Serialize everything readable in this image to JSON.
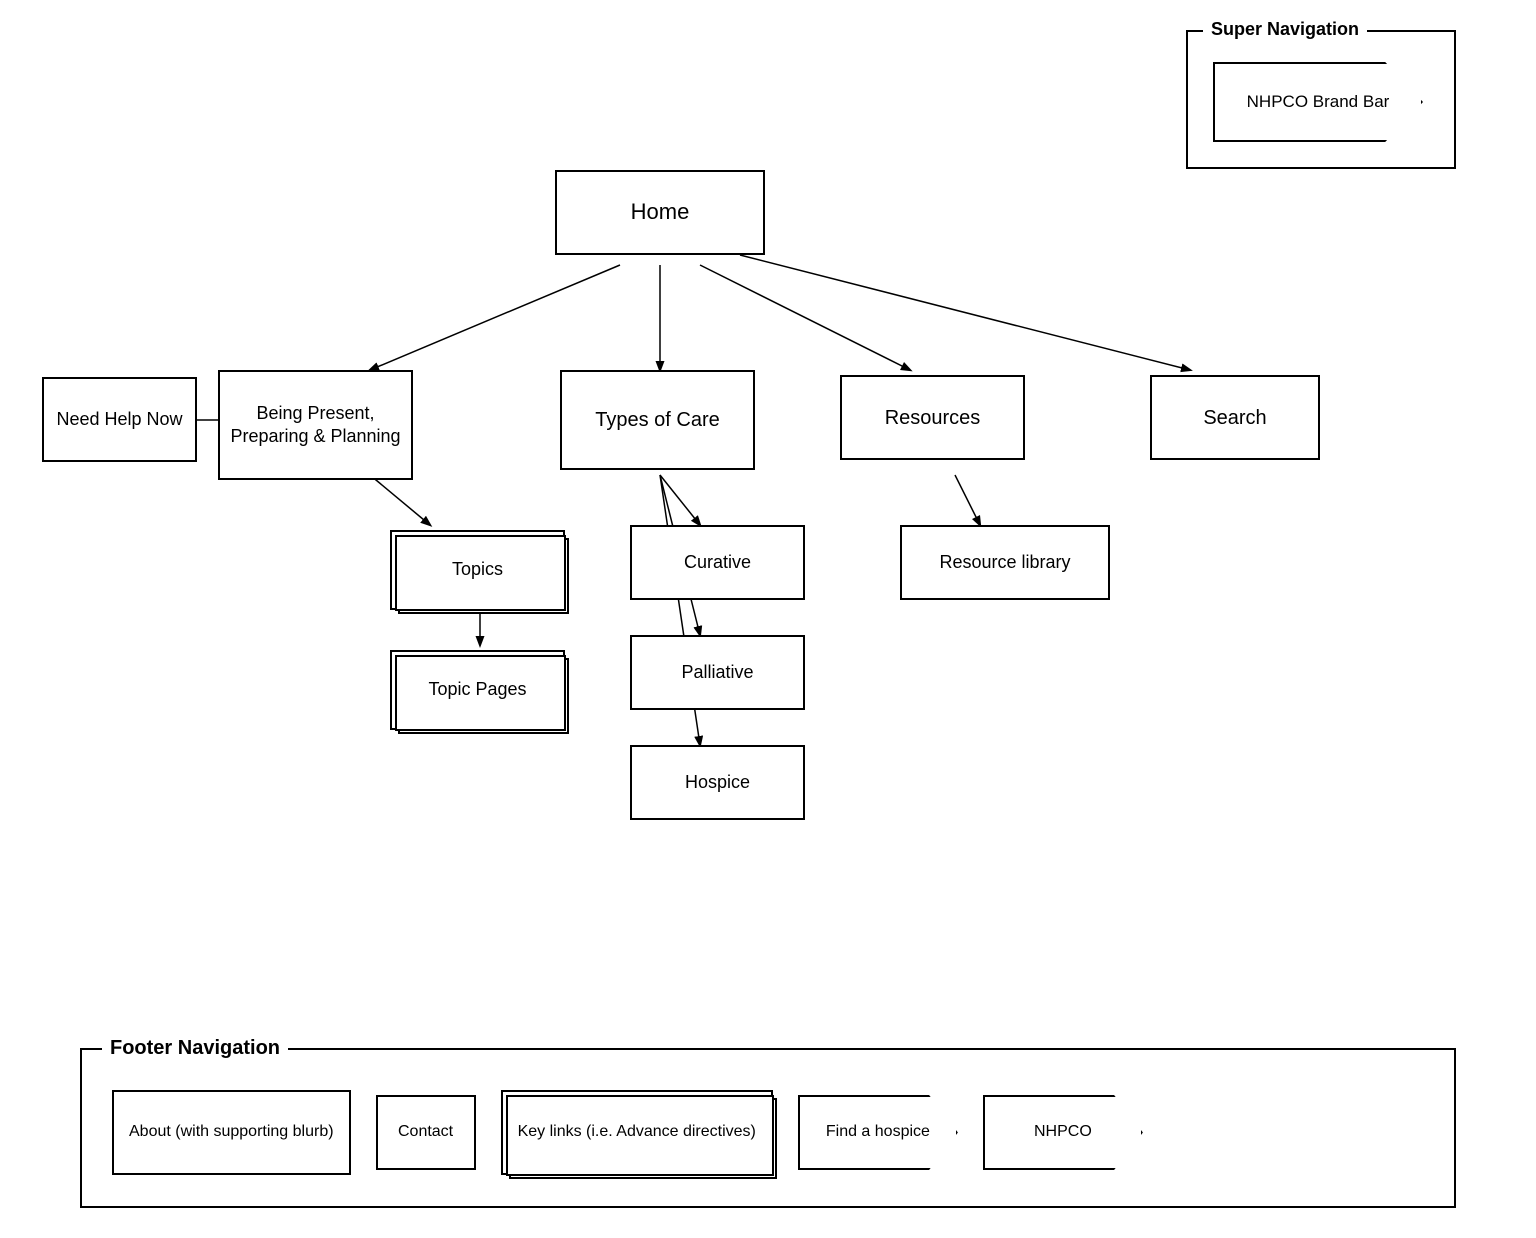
{
  "super_nav": {
    "label": "Super Navigation",
    "nhpco_brand_bar": "NHPCO Brand Bar"
  },
  "nodes": {
    "home": "Home",
    "need_help_now": "Need Help Now",
    "being_present": "Being Present, Preparing & Planning",
    "types_of_care": "Types of Care",
    "resources": "Resources",
    "search": "Search",
    "topics": "Topics",
    "topic_pages": "Topic Pages",
    "curative": "Curative",
    "palliative": "Palliative",
    "hospice": "Hospice",
    "resource_library": "Resource library"
  },
  "footer_nav": {
    "label": "Footer Navigation",
    "items": [
      {
        "label": "About (with supporting blurb)",
        "type": "box"
      },
      {
        "label": "Contact",
        "type": "box"
      },
      {
        "label": "Key links (i.e. Advance directives)",
        "type": "stacked"
      },
      {
        "label": "Find a hospice",
        "type": "arrow"
      },
      {
        "label": "NHPCO",
        "type": "arrow"
      }
    ]
  }
}
